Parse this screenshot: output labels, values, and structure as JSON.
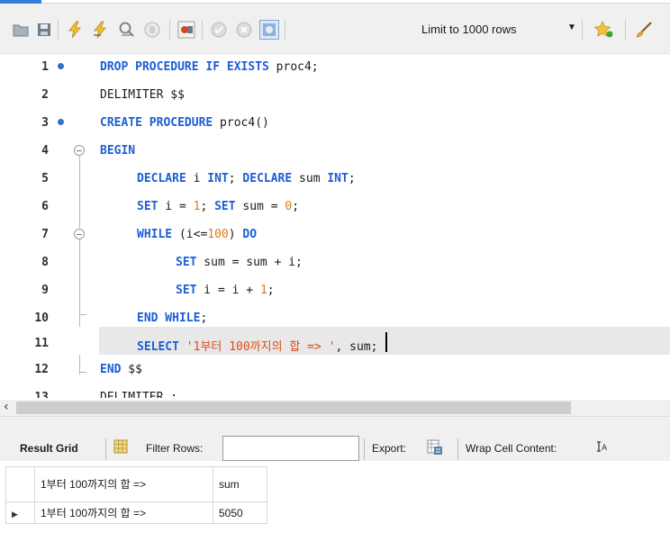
{
  "toolbar": {
    "limit_rows": "Limit to 1000 rows",
    "icons": [
      "open-folder-icon",
      "save-icon",
      "execute-icon",
      "execute-current-icon",
      "explain-icon",
      "stop-icon",
      "toggle-error-icon",
      "commit-icon",
      "rollback-icon",
      "autocommit-icon",
      "beautify-icon",
      "find-icon"
    ]
  },
  "editor": {
    "lines": [
      {
        "num": "1",
        "marker": true
      },
      {
        "num": "2",
        "marker": false
      },
      {
        "num": "3",
        "marker": true
      },
      {
        "num": "4",
        "marker": false
      },
      {
        "num": "5",
        "marker": false
      },
      {
        "num": "6",
        "marker": false
      },
      {
        "num": "7",
        "marker": false
      },
      {
        "num": "8",
        "marker": false
      },
      {
        "num": "9",
        "marker": false
      },
      {
        "num": "10",
        "marker": false
      },
      {
        "num": "11",
        "marker": false
      },
      {
        "num": "12",
        "marker": false
      },
      {
        "num": "13",
        "marker": false
      }
    ],
    "code": {
      "l1_kw": "DROP PROCEDURE IF EXISTS",
      "l1_tx": " proc4;",
      "l2_tx": "DELIMITER $$",
      "l3_kw": "CREATE PROCEDURE",
      "l3_tx": " proc4()",
      "l4_kw": "BEGIN",
      "l5_kw1": "DECLARE",
      "l5_tx1": " i ",
      "l5_kw2": "INT",
      "l5_tx2": "; ",
      "l5_kw3": "DECLARE",
      "l5_tx3": " sum ",
      "l5_kw4": "INT",
      "l5_tx4": ";",
      "l6_kw1": "SET",
      "l6_tx1": " i = ",
      "l6_nm1": "1",
      "l6_tx2": "; ",
      "l6_kw2": "SET",
      "l6_tx3": " sum = ",
      "l6_nm2": "0",
      "l6_tx4": ";",
      "l7_kw1": "WHILE",
      "l7_tx1": " (i<=",
      "l7_nm": "100",
      "l7_tx2": ") ",
      "l7_kw2": "DO",
      "l8_kw": "SET",
      "l8_tx": " sum = sum + i;",
      "l9_kw": "SET",
      "l9_tx1": " i = i + ",
      "l9_nm": "1",
      "l9_tx2": ";",
      "l10_kw": "END WHILE",
      "l10_tx": ";",
      "l11_kw": "SELECT",
      "l11_str": " '1부터 100까지의 합 => ",
      "l11_str2": "'",
      "l11_tx": ", sum;",
      "l12_kw": "END",
      "l12_tx": " $$",
      "l13_tx": "DELIMITER ;"
    }
  },
  "result": {
    "tab": "Result Grid",
    "filter_label": "Filter Rows:",
    "filter_value": "",
    "export_label": "Export:",
    "wrap_label": "Wrap Cell Content:",
    "columns": [
      "1부터 100까지의 합 =>",
      "sum"
    ],
    "rows": [
      [
        "1부터 100까지의 합 =>",
        "5050"
      ]
    ]
  }
}
